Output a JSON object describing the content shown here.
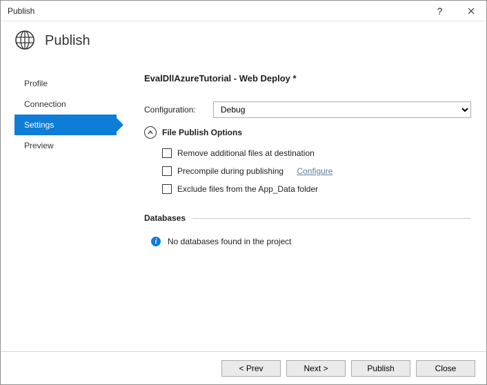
{
  "window": {
    "title": "Publish"
  },
  "header": {
    "title": "Publish"
  },
  "sidebar": {
    "items": [
      {
        "label": "Profile"
      },
      {
        "label": "Connection"
      },
      {
        "label": "Settings"
      },
      {
        "label": "Preview"
      }
    ],
    "selected_index": 2
  },
  "main": {
    "page_title": "EvalDllAzureTutorial - Web Deploy *",
    "configuration": {
      "label": "Configuration:",
      "value": "Debug",
      "options": [
        "Debug"
      ]
    },
    "file_publish": {
      "heading": "File Publish Options",
      "options": [
        {
          "label": "Remove additional files at destination",
          "checked": false
        },
        {
          "label": "Precompile during publishing",
          "checked": false,
          "link": "Configure"
        },
        {
          "label": "Exclude files from the App_Data folder",
          "checked": false
        }
      ]
    },
    "databases": {
      "heading": "Databases",
      "info": "No databases found in the project"
    }
  },
  "footer": {
    "prev": "< Prev",
    "next": "Next >",
    "publish": "Publish",
    "close": "Close"
  }
}
